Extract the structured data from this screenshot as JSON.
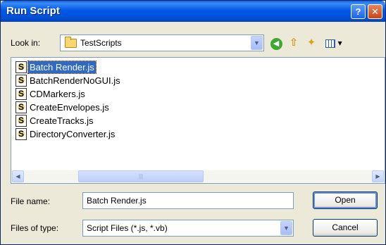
{
  "window": {
    "title": "Run Script",
    "help_glyph": "?",
    "close_glyph": "✕"
  },
  "lookin": {
    "label": "Look in:",
    "value": "TestScripts"
  },
  "files": [
    {
      "name": "Batch Render.js",
      "selected": true
    },
    {
      "name": "BatchRenderNoGUI.js",
      "selected": false
    },
    {
      "name": "CDMarkers.js",
      "selected": false
    },
    {
      "name": "CreateEnvelopes.js",
      "selected": false
    },
    {
      "name": "CreateTracks.js",
      "selected": false
    },
    {
      "name": "DirectoryConverter.js",
      "selected": false
    }
  ],
  "file_icon_glyph": "S",
  "filename": {
    "label": "File name:",
    "value": "Batch Render.js"
  },
  "filetype": {
    "label": "Files of type:",
    "value": "Script Files (*.js, *.vb)"
  },
  "buttons": {
    "open": "Open",
    "cancel": "Cancel"
  },
  "colors": {
    "selection": "#316AC5",
    "titlebar": "#0058E6",
    "dialog_bg": "#ECE9D8"
  }
}
